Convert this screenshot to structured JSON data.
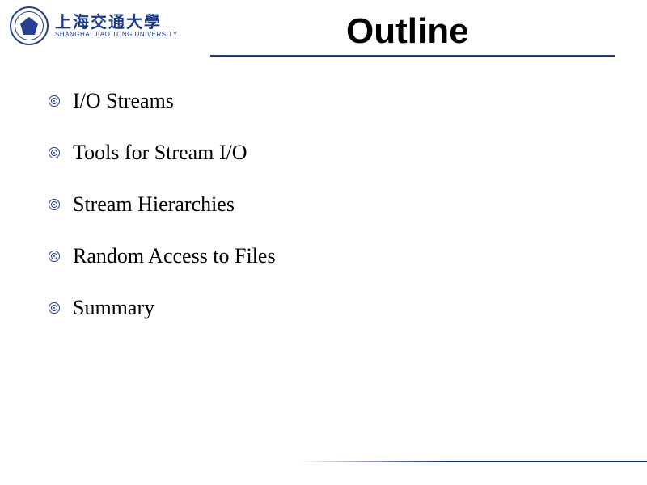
{
  "header": {
    "logo": {
      "cn": "上海交通大學",
      "en": "Shanghai Jiao Tong University"
    },
    "title": "Outline"
  },
  "bullets": [
    {
      "text": "I/O Streams"
    },
    {
      "text": "Tools for Stream I/O"
    },
    {
      "text": "Stream Hierarchies"
    },
    {
      "text": "Random Access to Files"
    },
    {
      "text": "Summary"
    }
  ]
}
